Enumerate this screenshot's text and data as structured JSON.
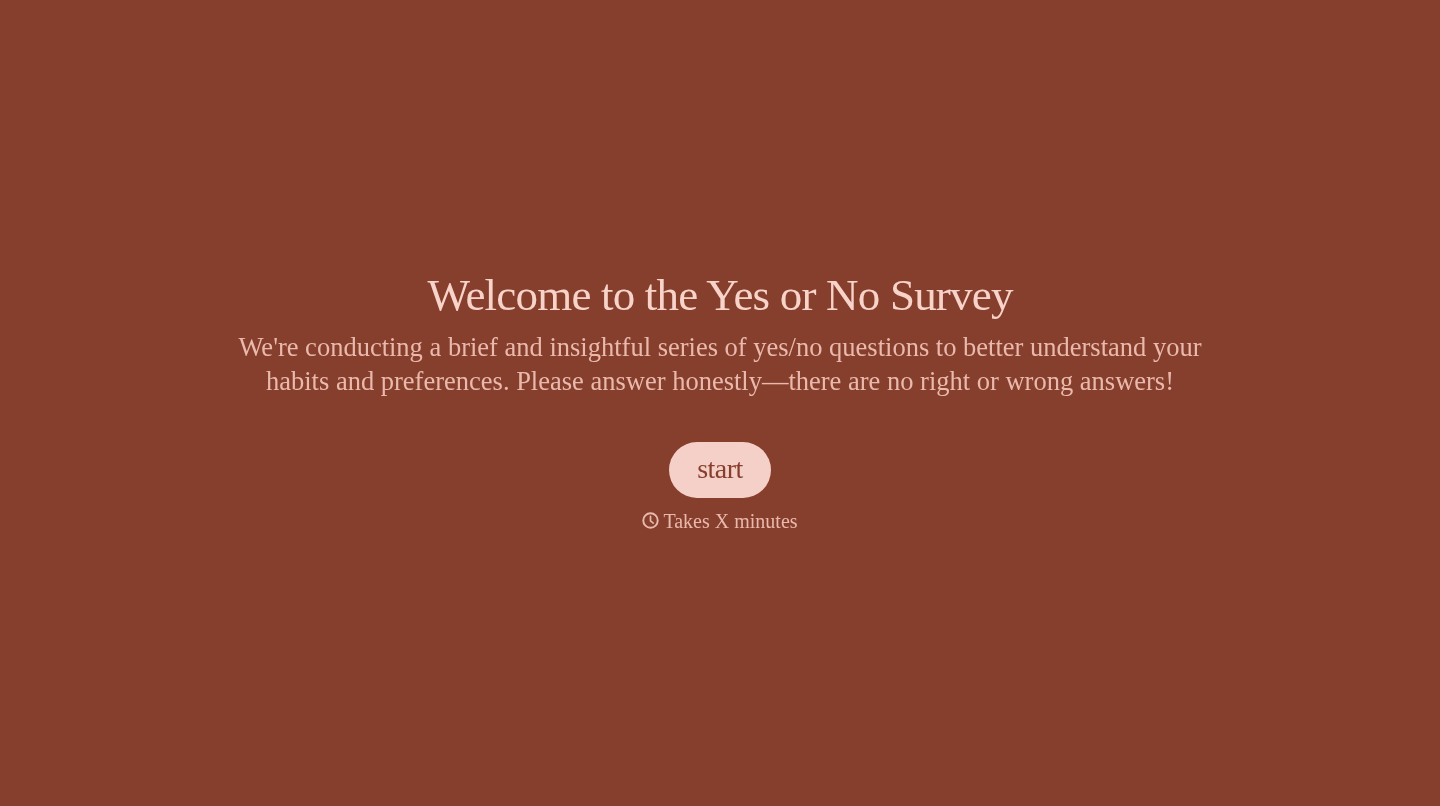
{
  "title": "Welcome to the Yes or No Survey",
  "intro": "We're conducting a brief and insightful series of yes/no questions to better understand your habits and preferences. Please answer honestly—there are no right or wrong answers!",
  "start_button": {
    "label": "start"
  },
  "duration": {
    "text": "Takes X minutes"
  }
}
